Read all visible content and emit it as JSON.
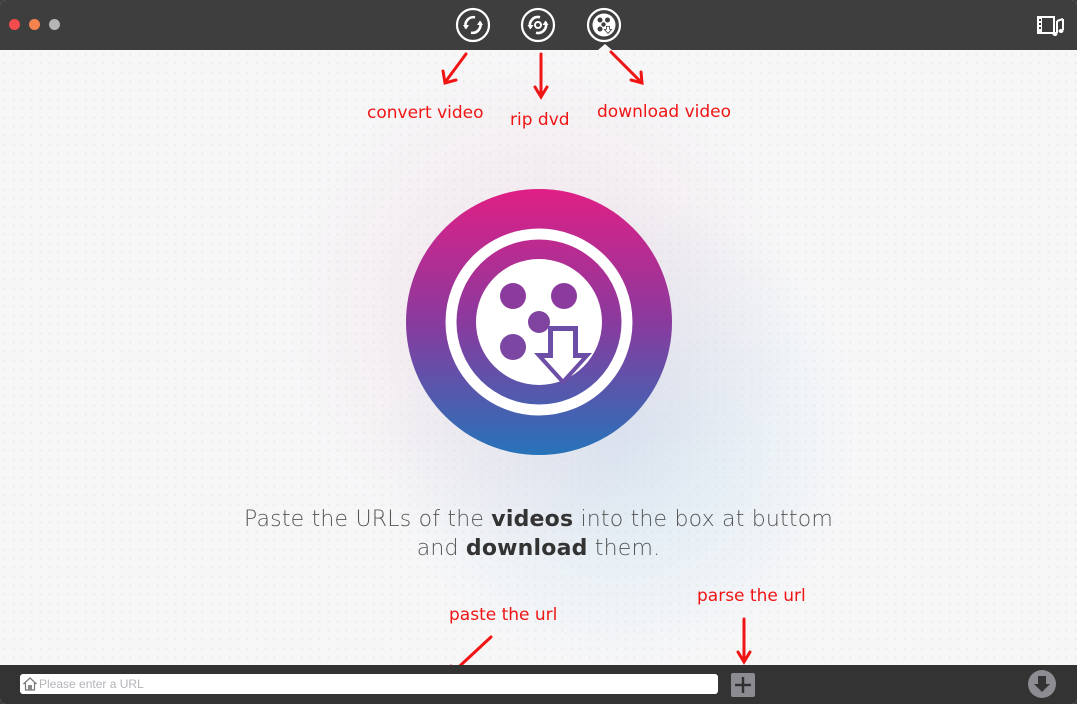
{
  "window": {
    "traffic_lights": [
      "close",
      "minimize",
      "maximize"
    ]
  },
  "toolbar": {
    "tools": [
      {
        "name": "convert-video",
        "icon": "convert-icon",
        "active": false
      },
      {
        "name": "rip-dvd",
        "icon": "rip-dvd-icon",
        "active": false
      },
      {
        "name": "download-video",
        "icon": "film-reel-download-icon",
        "active": true
      }
    ],
    "right_button_icon": "media-library-icon"
  },
  "annotations": {
    "convert_video": "convert video",
    "rip_dvd": "rip dvd",
    "download_video": "download video",
    "paste_url": "paste the url",
    "parse_url": "parse the url",
    "color": "#f01515"
  },
  "main": {
    "logo_icon": "film-reel-download-icon",
    "message": {
      "line1_prefix": "Paste the URLs of the ",
      "line1_bold": "videos",
      "line1_suffix": " into the box at buttom",
      "line2_prefix": "and ",
      "line2_bold": "download",
      "line2_suffix": " them."
    },
    "logo_colors": {
      "top": "#e01f85",
      "middle": "#8a3a9e",
      "bottom": "#2673b9"
    }
  },
  "bottombar": {
    "url_field": {
      "value": "",
      "placeholder": "Please enter a URL",
      "icon": "home-icon"
    },
    "add_button_icon": "plus-icon",
    "download_button_icon": "download-arrow-icon"
  }
}
